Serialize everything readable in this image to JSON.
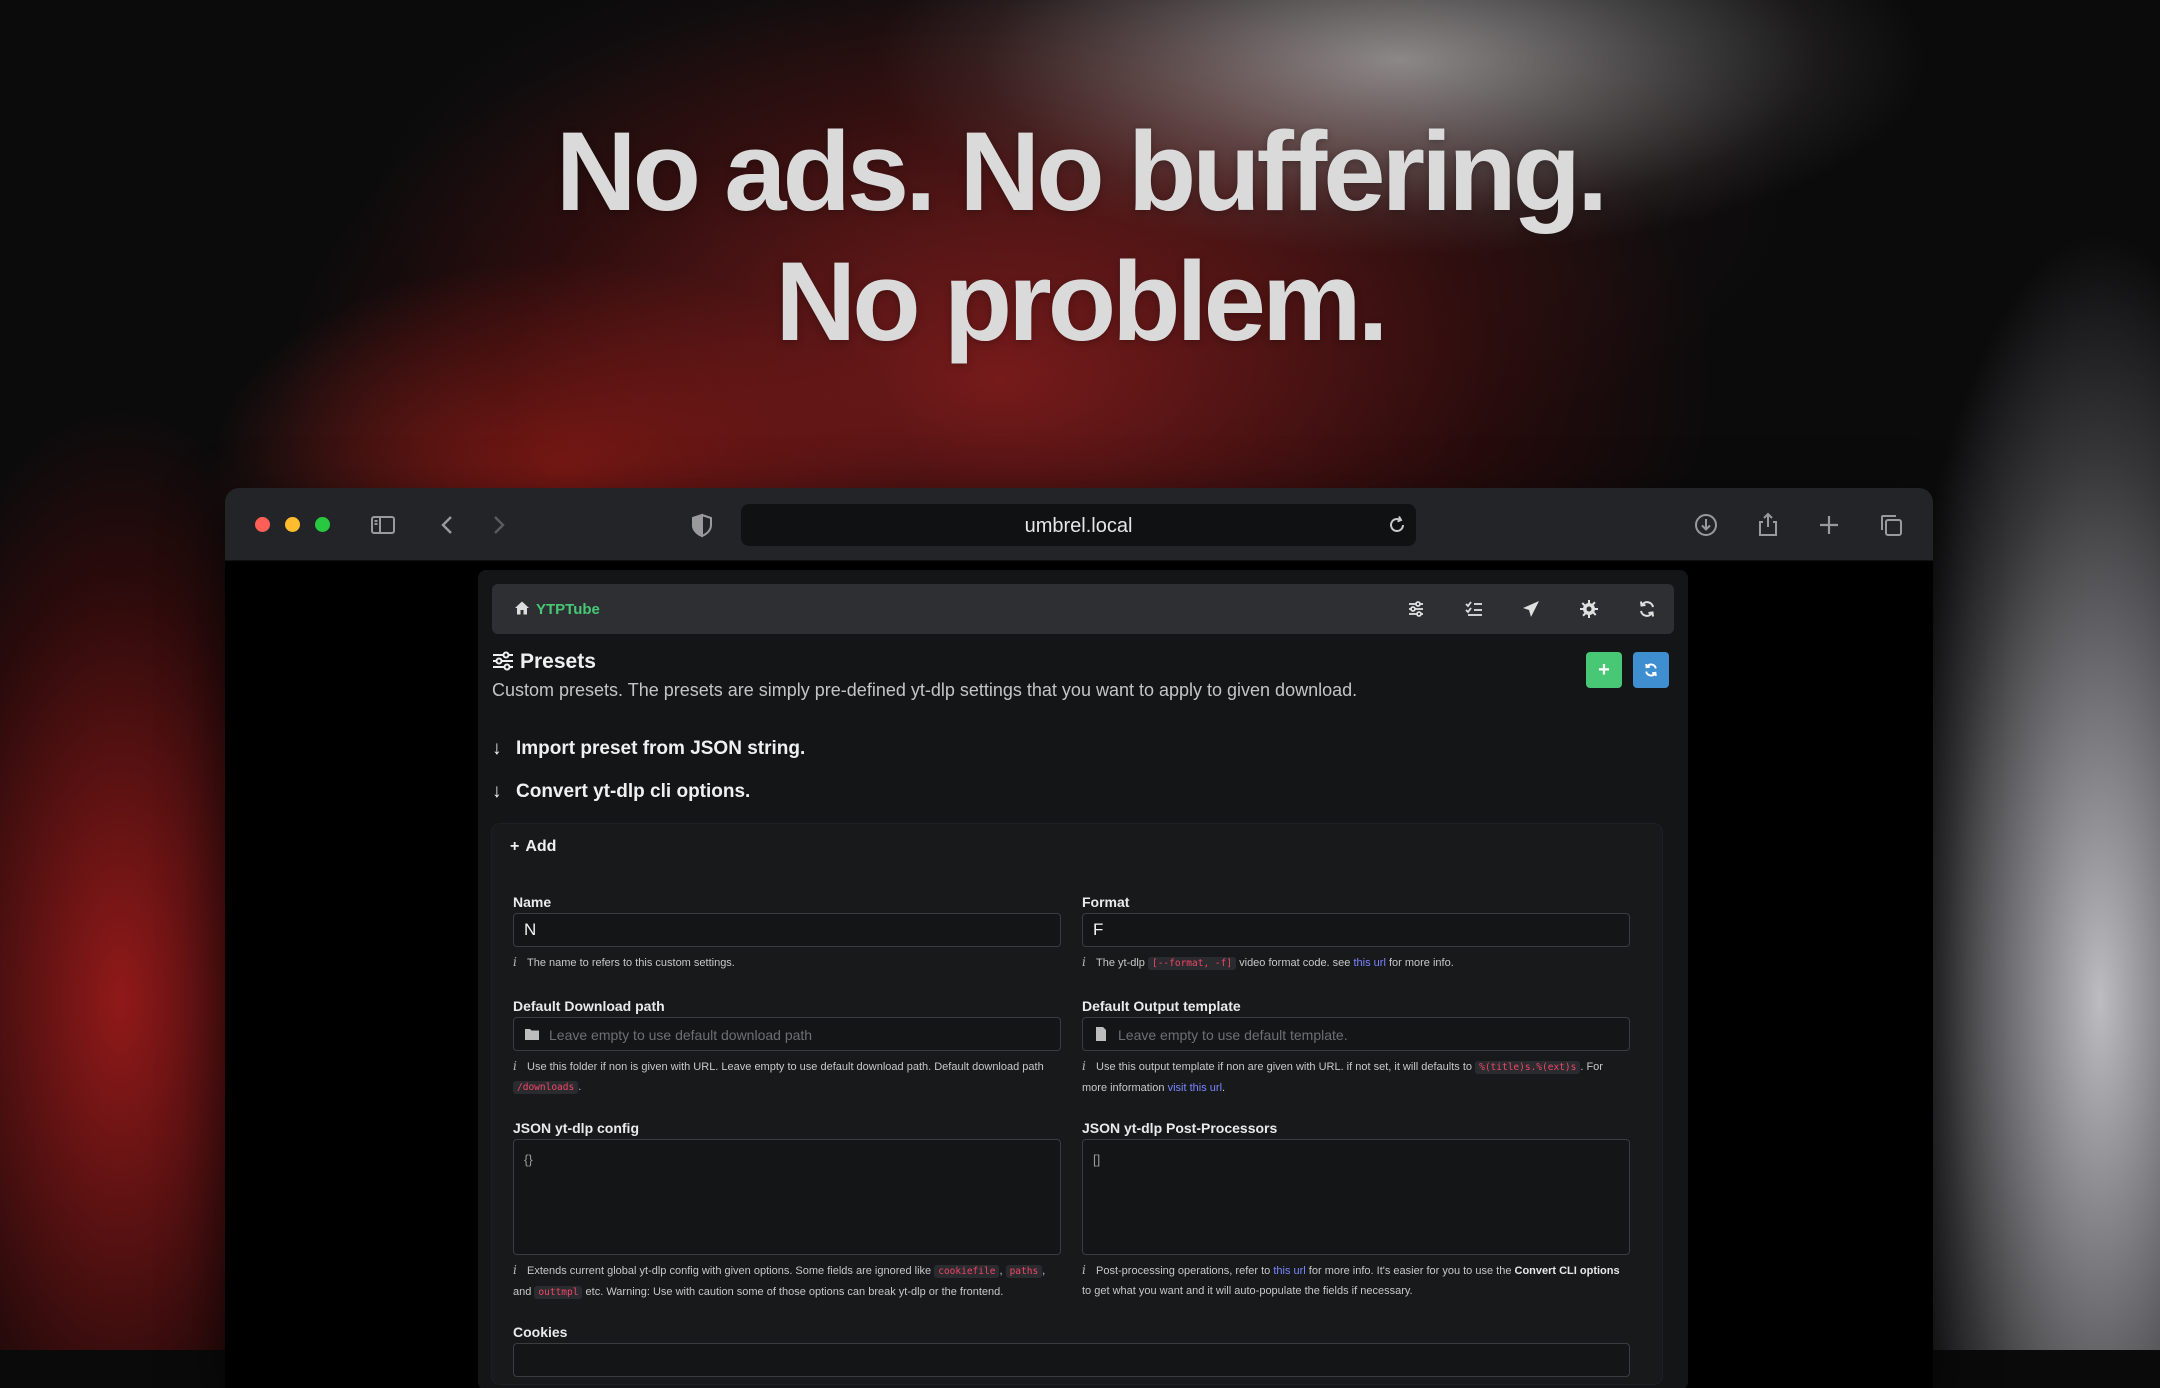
{
  "headline": {
    "line1": "No ads. No buffering.",
    "line2": "No problem."
  },
  "browser": {
    "url": "umbrel.local",
    "icons": [
      "sidebar-icon",
      "back-icon",
      "forward-icon",
      "shield-icon",
      "reload-icon",
      "download-icon",
      "share-icon",
      "new-tab-icon",
      "tabs-icon"
    ]
  },
  "app": {
    "brand": "YTPTube",
    "nav_icons": [
      "sliders-icon",
      "tasks-icon",
      "send-icon",
      "settings-icon",
      "refresh-icon"
    ],
    "page_title": "Presets",
    "page_description": "Custom presets. The presets are simply pre-defined yt-dlp settings that you want to apply to given download.",
    "add_button": "+",
    "sections": {
      "import_json": "Import preset from JSON string.",
      "convert_cli": "Convert yt-dlp cli options."
    },
    "form": {
      "header": "Add",
      "name": {
        "label": "Name",
        "value": "N",
        "help": "The name to refers to this custom settings."
      },
      "format": {
        "label": "Format",
        "value": "F",
        "help_pre": "The yt-dlp",
        "help_code": "[--format, -f]",
        "help_mid": "video format code. see",
        "help_link": "this url",
        "help_post": "for more info."
      },
      "download_path": {
        "label": "Default Download path",
        "placeholder": "Leave empty to use default download path",
        "help_pre": "Use this folder if non is given with URL. Leave empty to use default download path. Default download path",
        "help_code": "/downloads",
        "help_post": "."
      },
      "output_template": {
        "label": "Default Output template",
        "placeholder": "Leave empty to use default template.",
        "help_pre": "Use this output template if non are given with URL. if not set, it will defaults to",
        "help_code": "%(title)s.%(ext)s",
        "help_mid": ". For more information",
        "help_link": "visit this url",
        "help_post": "."
      },
      "ytdlp_config": {
        "label": "JSON yt-dlp config",
        "value": "{}",
        "help_pre": "Extends current global yt-dlp config with given options. Some fields are ignored like",
        "help_code1": "cookiefile",
        "help_sep": ",",
        "help_code2": "paths",
        "help_and": ", and",
        "help_code3": "outtmpl",
        "help_post": "etc. Warning: Use with caution some of those options can break yt-dlp or the frontend."
      },
      "postprocessors": {
        "label": "JSON yt-dlp Post-Processors",
        "value": "[]",
        "help_pre": "Post-processing operations, refer to",
        "help_link": "this url",
        "help_mid": "for more info. It's easier for you to use the",
        "help_bold": "Convert CLI options",
        "help_post": "to get what you want and it will auto-populate the fields if necessary."
      },
      "cookies": {
        "label": "Cookies"
      }
    }
  }
}
